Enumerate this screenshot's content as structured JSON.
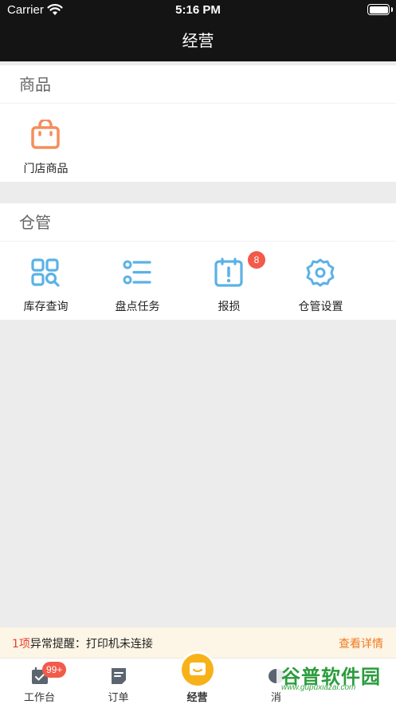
{
  "status_bar": {
    "carrier": "Carrier",
    "time": "5:16 PM"
  },
  "nav": {
    "title": "经营"
  },
  "colors": {
    "accent_orange": "#f58e5a",
    "icon_blue": "#5bb2e6",
    "badge_red": "#f25a4a",
    "center_yellow": "#f7b21a"
  },
  "sections": {
    "products": {
      "title": "商品",
      "items": [
        {
          "label": "门店商品",
          "icon": "shopping-bag-icon"
        }
      ]
    },
    "warehouse": {
      "title": "仓管",
      "items": [
        {
          "label": "库存查询",
          "icon": "inventory-search-icon"
        },
        {
          "label": "盘点任务",
          "icon": "checklist-icon"
        },
        {
          "label": "报损",
          "icon": "damage-report-icon",
          "badge": "8"
        },
        {
          "label": "仓管设置",
          "icon": "gear-icon"
        }
      ]
    }
  },
  "alert": {
    "count": "1项",
    "text": "异常提醒：打印机未连接",
    "link": "查看详情"
  },
  "tabbar": {
    "tabs": [
      {
        "label": "工作台",
        "icon": "workbench-icon",
        "badge": "99+"
      },
      {
        "label": "订单",
        "icon": "order-icon"
      },
      {
        "label": "经营",
        "icon": "business-icon"
      },
      {
        "label": "消",
        "icon": "message-icon"
      }
    ]
  },
  "watermark": {
    "main": "谷普软件园",
    "sub": "www.gupuxiazai.com"
  }
}
